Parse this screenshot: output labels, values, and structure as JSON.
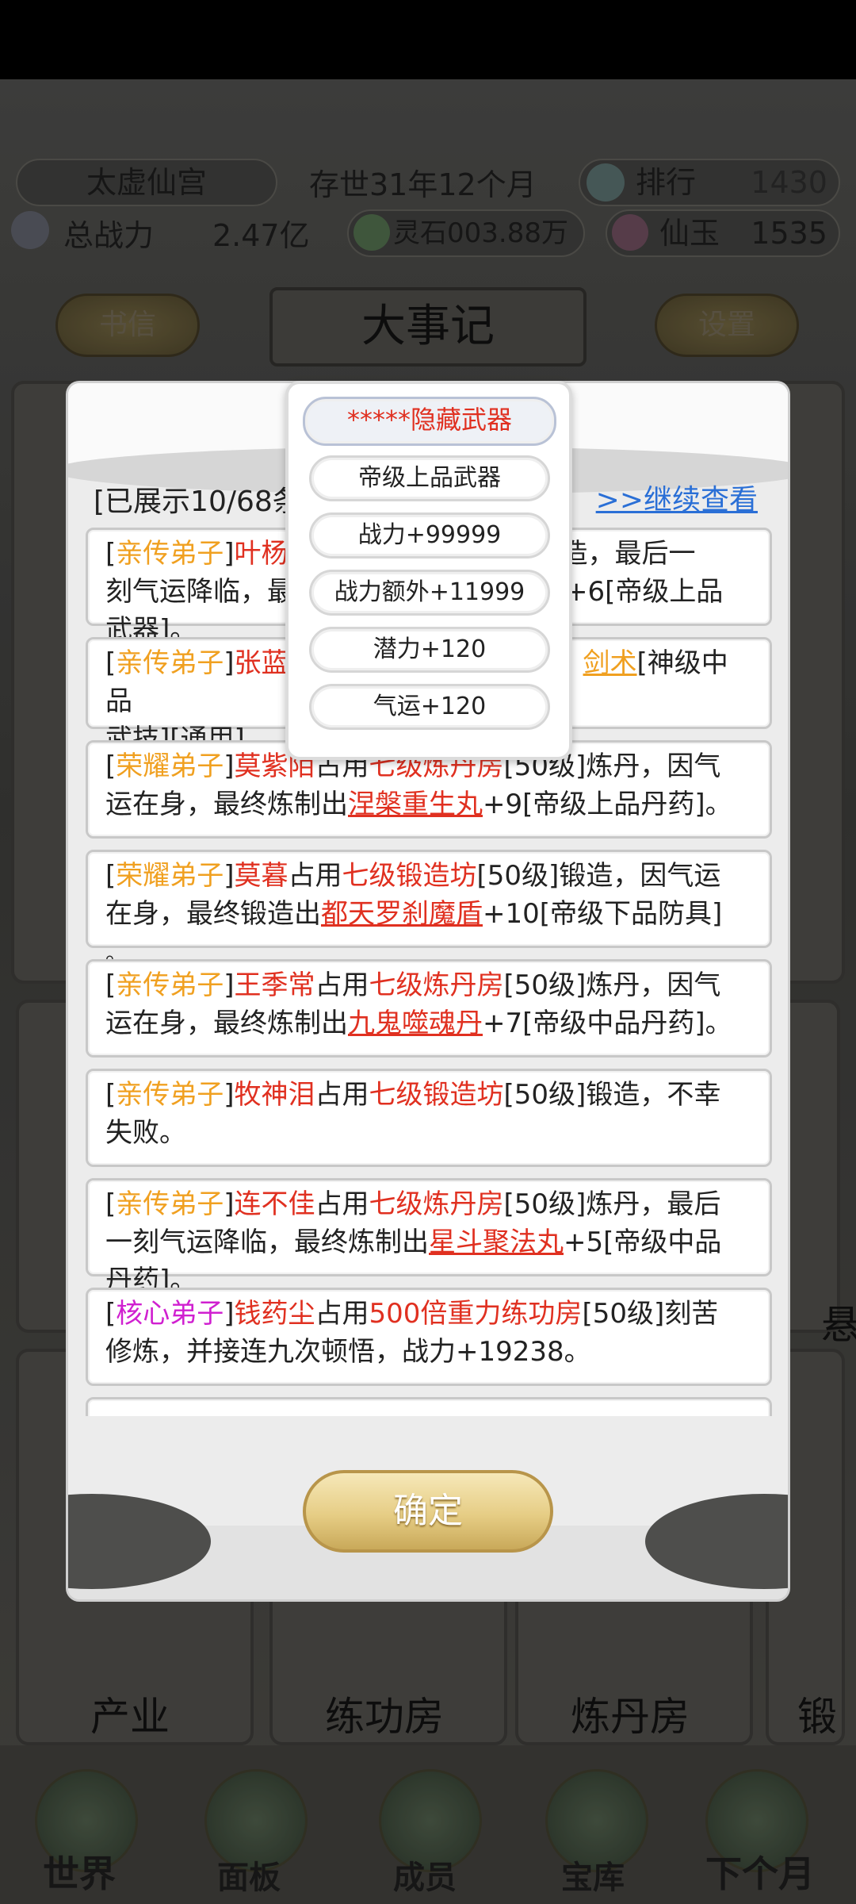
{
  "header": {
    "sect_name": "太虚仙宫",
    "age": "存世31年12个月",
    "rank_label": "排行",
    "rank_value": "1430",
    "power_label": "总战力",
    "power_value": "2.47亿",
    "spirit_stone": "灵石003.88万",
    "jade_label": "仙玉",
    "jade_value": "1535"
  },
  "top_buttons": {
    "letters": "书信",
    "title": "大事记",
    "settings": "设置"
  },
  "background": {
    "facility_labels": [
      "产业",
      "练功房",
      "炼丹房",
      "锻"
    ],
    "side_label": "悬"
  },
  "bottom_nav": [
    "世界",
    "面板",
    "成员",
    "宝库",
    "下个月"
  ],
  "dialog": {
    "showing": "[已展示10/68条",
    "more": ">>继续查看",
    "confirm": "确定",
    "entries": [
      {
        "tag": "[亲传弟子]",
        "tag_color": "#f0a020",
        "html_parts": [
          "[",
          "亲传弟子",
          "]",
          "叶杨",
          "锻造，最后一刻气运降临，最",
          "+6[帝级上品武器]。"
        ]
      },
      {
        "tag": "[亲传弟子]"
      },
      {
        "tag": "[荣耀弟子]"
      },
      {
        "tag": "[荣耀弟子]"
      },
      {
        "tag": "[亲传弟子]"
      },
      {
        "tag": "[亲传弟子]"
      },
      {
        "tag": "[亲传弟子]"
      },
      {
        "tag": "[核心弟子]"
      }
    ],
    "e1": {
      "t": "亲传弟子",
      "n": "叶杨",
      "a": "锻造，最后一",
      "b": "刻气运降临，最",
      "c": "+6[帝级上品",
      "d": "武器]。"
    },
    "e2": {
      "t": "亲传弟子",
      "n": "张蓝",
      "i": "剑术",
      "a": "[神级中品",
      "b": "武技][通用]。"
    },
    "e3": {
      "t": "荣耀弟子",
      "n": "莫紫陌",
      "p": "七级炼丹房",
      "a": "[50级]炼丹，因气",
      "b": "运在身，最终炼制出",
      "i": "涅槃重生丸",
      "c": "+9[帝级上品丹药]。"
    },
    "e4": {
      "t": "荣耀弟子",
      "n": "莫暮",
      "p": "七级锻造坊",
      "a": "[50级]锻造，因气运",
      "b": "在身，最终锻造出",
      "i": "都天罗刹魔盾",
      "c": "+10[帝级下品防具]",
      "d": "。"
    },
    "e5": {
      "t": "亲传弟子",
      "n": "王季常",
      "p": "七级炼丹房",
      "a": "[50级]炼丹，因气",
      "b": "运在身，最终炼制出",
      "i": "九鬼噬魂丹",
      "c": "+7[帝级中品丹药]。"
    },
    "e6": {
      "t": "亲传弟子",
      "n": "牧神泪",
      "p": "七级锻造坊",
      "a": "[50级]锻造，不幸",
      "b": "失败。"
    },
    "e7": {
      "t": "亲传弟子",
      "n": "连不佳",
      "p": "七级炼丹房",
      "a": "[50级]炼丹，最后",
      "b": "一刻气运降临，最终炼制出",
      "i": "星斗聚法丸",
      "c": "+5[帝级中品",
      "d": "丹药]。"
    },
    "e8": {
      "t": "核心弟子",
      "n": "钱药尘",
      "p": "500倍重力练功房",
      "a": "[50级]刻苦",
      "b": "修炼，并接连九次顿悟，战力+19238。"
    },
    "occupy": "占用"
  },
  "popup": {
    "name": "*****隐藏武器",
    "grade": "帝级上品武器",
    "power": "战力+99999",
    "extra_power": "战力额外+11999",
    "potential": "潜力+120",
    "luck": "气运+120"
  }
}
